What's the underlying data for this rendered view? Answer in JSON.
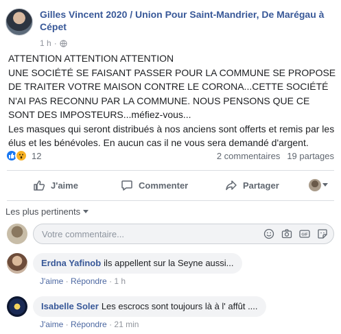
{
  "post": {
    "author": "Gilles Vincent 2020 / Union Pour Saint-Mandrier, De Marégau à Cépet",
    "time": "1 h",
    "separator": "·",
    "privacy_icon": "globe-icon",
    "text": "ATTENTION ATTENTION ATTENTION\nUNE SOCIÉTÉ SE FAISANT PASSER POUR LA COMMUNE SE PROPOSE DE TRAITER VOTRE MAISON CONTRE LE CORONA...CETTE SOCIÉTÉ N'AI PAS RECONNU PAR LA COMMUNE. NOUS PENSONS QUE CE SONT DES IMPOSTEURS...méfiez-vous...\nLes masques qui seront distribués à nos anciens sont offerts et remis par les élus et les bénévoles. En aucun cas il ne vous sera demandé d'argent."
  },
  "stats": {
    "reactions_count": "12",
    "comments": "2 commentaires",
    "shares": "19 partages"
  },
  "actions": {
    "like": "J'aime",
    "comment": "Commenter",
    "share": "Partager"
  },
  "sort": {
    "label": "Les plus pertinents"
  },
  "compose": {
    "placeholder": "Votre commentaire..."
  },
  "comments": [
    {
      "name": "Erdna Yafinob",
      "text": "ils appellent sur la Seyne aussi...",
      "like": "J'aime",
      "reply": "Répondre",
      "time": "1 h"
    },
    {
      "name": "Isabelle Soler",
      "text": "Les escrocs sont toujours là à l' affût ....",
      "like": "J'aime",
      "reply": "Répondre",
      "time": "21 min"
    }
  ],
  "colors": {
    "link": "#385898",
    "accent": "#1877f2",
    "muted": "#90949c",
    "bubble": "#f2f3f5"
  }
}
